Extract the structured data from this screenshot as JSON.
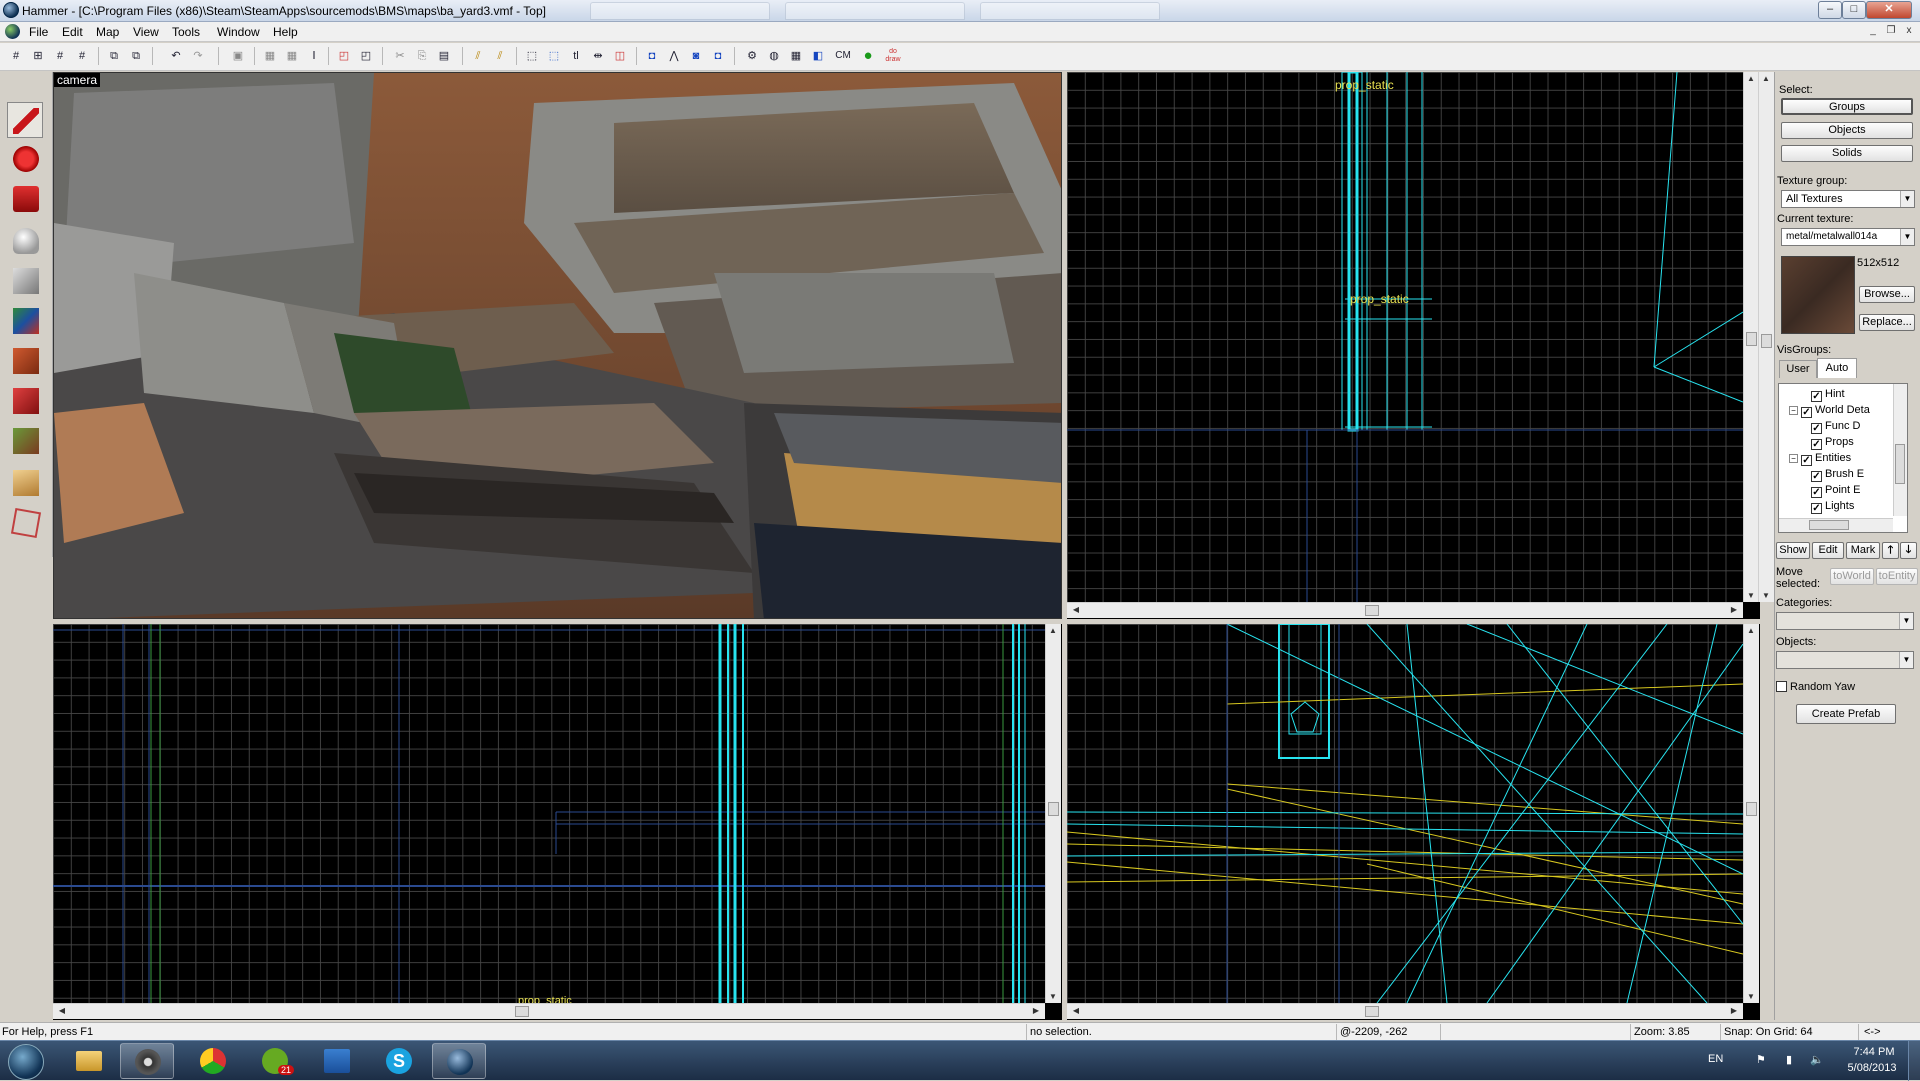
{
  "window": {
    "title": "Hammer - [C:\\Program Files (x86)\\Steam\\SteamApps\\sourcemods\\BMS\\maps\\ba_yard3.vmf - Top]",
    "min_label": "–",
    "max_label": "□",
    "close_label": "✕"
  },
  "menu": {
    "items": [
      "File",
      "Edit",
      "Map",
      "View",
      "Tools",
      "Window",
      "Help"
    ],
    "mdi_buttons": [
      "_",
      "❐",
      "x"
    ]
  },
  "toolbar": {
    "icons": [
      "grid-icon",
      "grid-dots-icon",
      "grid-smaller-icon",
      "grid-larger-icon",
      "group-icon",
      "ungroup-icon",
      "undo-icon",
      "redo-icon",
      "carve-icon",
      "texture-lock-icon",
      "hollow-icon",
      "resize-icon",
      "cordon-icon",
      "hide-icon",
      "cut-icon",
      "copy-icon",
      "paste-icon",
      "toggle-texlock-icon",
      "texture-scale-icon",
      "select-bbox-icon",
      "select-handles-icon",
      "text-icon",
      "move-icon",
      "ignore-groups-icon",
      "flip-h-icon",
      "flip-v-icon",
      "align-icon",
      "merge-icon",
      "compile-icon",
      "sphere-icon",
      "3d-view-icon",
      "cubes-icon",
      "cm-label",
      "helpers-icon",
      "draw-icon"
    ],
    "cm_label": "CM",
    "draw_label": "do draw"
  },
  "left_tools": [
    {
      "name": "selection-tool",
      "active": true,
      "color": "#c8161a"
    },
    {
      "name": "magnify-tool",
      "active": false,
      "color": "#c8161a"
    },
    {
      "name": "camera-tool",
      "active": false,
      "color": "#c81e20"
    },
    {
      "name": "entity-tool",
      "active": false,
      "color": "#aaaaaa"
    },
    {
      "name": "block-tool",
      "active": false,
      "color": "#8e8e8e"
    },
    {
      "name": "texture-application-tool",
      "active": false,
      "color": "#3a7a40"
    },
    {
      "name": "apply-current-texture-tool",
      "active": false,
      "color": "#b84020"
    },
    {
      "name": "decal-tool",
      "active": false,
      "color": "#c03030"
    },
    {
      "name": "overlay-tool",
      "active": false,
      "color": "#5a7a3a"
    },
    {
      "name": "clipping-tool",
      "active": false,
      "color": "#d8a850"
    },
    {
      "name": "vertex-tool",
      "active": false,
      "color": "#c04040"
    }
  ],
  "viewports": {
    "camera_label": "camera",
    "top_labels": [
      "prop_static",
      "prop_static"
    ],
    "front_label": "prop_static"
  },
  "right_panel": {
    "select_label": "Select:",
    "groups_btn": "Groups",
    "objects_btn": "Objects",
    "solids_btn": "Solids",
    "texture_group_label": "Texture group:",
    "texture_group_value": "All Textures",
    "current_texture_label": "Current texture:",
    "current_texture_value": "metal/metalwall014a",
    "texture_size": "512x512",
    "browse_btn": "Browse...",
    "replace_btn": "Replace...",
    "visgroups_label": "VisGroups:",
    "tab_user": "User",
    "tab_auto": "Auto",
    "visgroups": [
      {
        "label": "Hint",
        "indent": 2,
        "checked": true,
        "twisty": ""
      },
      {
        "label": "World Deta",
        "indent": 1,
        "checked": true,
        "twisty": "−"
      },
      {
        "label": "Func D",
        "indent": 2,
        "checked": true,
        "twisty": ""
      },
      {
        "label": "Props",
        "indent": 2,
        "checked": true,
        "twisty": ""
      },
      {
        "label": "Entities",
        "indent": 1,
        "checked": true,
        "twisty": "−"
      },
      {
        "label": "Brush E",
        "indent": 2,
        "checked": true,
        "twisty": ""
      },
      {
        "label": "Point E",
        "indent": 2,
        "checked": true,
        "twisty": ""
      },
      {
        "label": "Lights",
        "indent": 2,
        "checked": true,
        "twisty": ""
      }
    ],
    "show_btn": "Show",
    "edit_btn": "Edit",
    "mark_btn": "Mark",
    "up_btn": "🡑",
    "down_btn": "🡓",
    "move_selected_label": "Move selected:",
    "to_world_btn": "toWorld",
    "to_entity_btn": "toEntity",
    "categories_label": "Categories:",
    "objects_label": "Objects:",
    "random_yaw_label": "Random Yaw",
    "create_prefab_btn": "Create Prefab"
  },
  "status": {
    "help": "For Help, press F1",
    "selection": "no selection.",
    "coords": "@-2209, -262",
    "zoom": "Zoom: 3.85",
    "snap": "Snap: On Grid: 64",
    "arrows": "<->"
  },
  "taskbar": {
    "apps": [
      "start-orb",
      "file-explorer",
      "steam",
      "chrome",
      "spotify",
      "outlook",
      "skype",
      "hammer"
    ],
    "spotify_badge": "21",
    "lang": "EN",
    "time": "7:44 PM",
    "date": "5/08/2013"
  },
  "colors": {
    "wire_cyan": "#28e4f0",
    "wire_yellow": "#d8c820",
    "grid": "#464646",
    "grid_major": "#2a4a90"
  }
}
